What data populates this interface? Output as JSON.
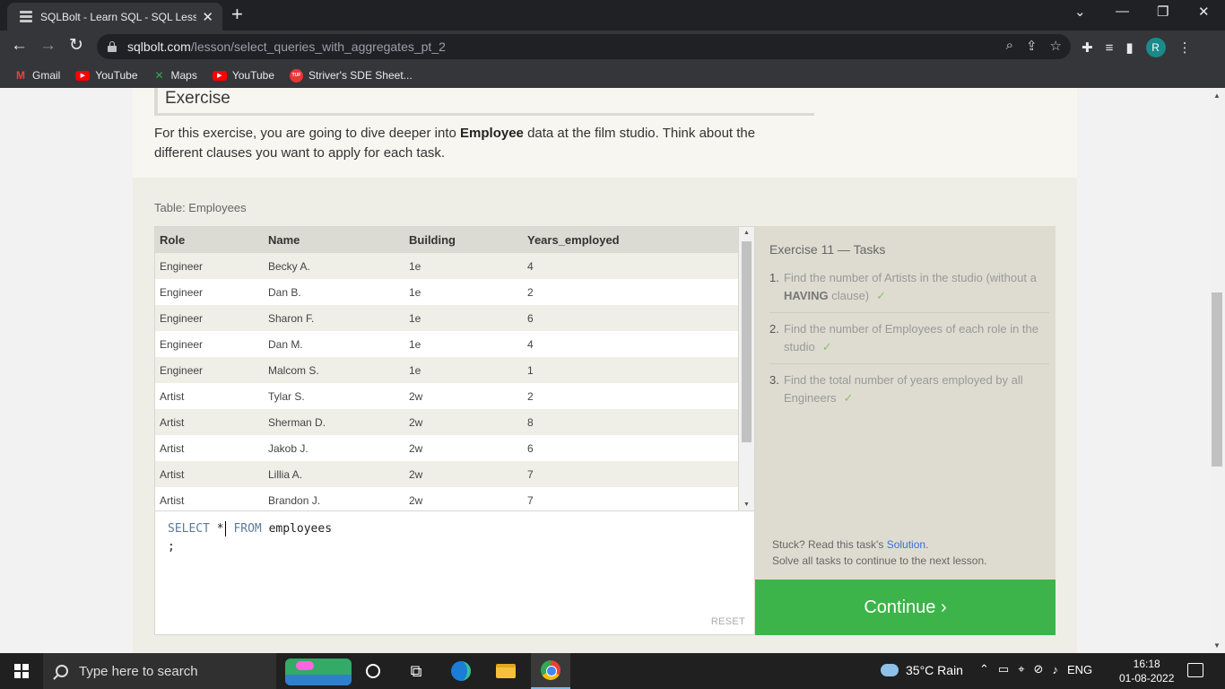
{
  "browser": {
    "tab_title": "SQLBolt - Learn SQL - SQL Lesso",
    "url_host": "sqlbolt.com",
    "url_path": "/lesson/select_queries_with_aggregates_pt_2",
    "avatar_letter": "R",
    "bookmarks": [
      {
        "label": "Gmail",
        "icon": "gmail-icon"
      },
      {
        "label": "YouTube",
        "icon": "youtube-icon"
      },
      {
        "label": "Maps",
        "icon": "maps-icon"
      },
      {
        "label": "YouTube",
        "icon": "youtube-icon"
      },
      {
        "label": "Striver's SDE Sheet...",
        "icon": "tuf-icon"
      }
    ]
  },
  "exercise": {
    "header": "Exercise",
    "intro_before": "For this exercise, you are going to dive deeper into ",
    "intro_bold": "Employee",
    "intro_after": " data at the film studio. Think about the different clauses you want to apply for each task.",
    "table_caption": "Table: Employees"
  },
  "table": {
    "columns": [
      "Role",
      "Name",
      "Building",
      "Years_employed"
    ],
    "rows": [
      [
        "Engineer",
        "Becky A.",
        "1e",
        "4"
      ],
      [
        "Engineer",
        "Dan B.",
        "1e",
        "2"
      ],
      [
        "Engineer",
        "Sharon F.",
        "1e",
        "6"
      ],
      [
        "Engineer",
        "Dan M.",
        "1e",
        "4"
      ],
      [
        "Engineer",
        "Malcom S.",
        "1e",
        "1"
      ],
      [
        "Artist",
        "Tylar S.",
        "2w",
        "2"
      ],
      [
        "Artist",
        "Sherman D.",
        "2w",
        "8"
      ],
      [
        "Artist",
        "Jakob J.",
        "2w",
        "6"
      ],
      [
        "Artist",
        "Lillia A.",
        "2w",
        "7"
      ],
      [
        "Artist",
        "Brandon J.",
        "2w",
        "7"
      ]
    ]
  },
  "editor": {
    "kw_select": "SELECT",
    "star": "*",
    "kw_from": "FROM",
    "table_name": "employees",
    "line2": ";",
    "reset_label": "RESET"
  },
  "tasks": {
    "title": "Exercise 11 — Tasks",
    "items": [
      {
        "num": "1.",
        "before": "Find the number of Artists in the studio (without a ",
        "bold": "HAVING",
        "after": " clause)",
        "check": "✓"
      },
      {
        "num": "2.",
        "before": "Find the number of Employees of each role in the studio",
        "bold": "",
        "after": "",
        "check": "✓"
      },
      {
        "num": "3.",
        "before": "Find the total number of years employed by all Engineers",
        "bold": "",
        "after": "",
        "check": "✓"
      }
    ],
    "stuck_text": "Stuck? Read this task's ",
    "solution_link": "Solution",
    "stuck_end": ".",
    "solve_all": "Solve all tasks to continue to the next lesson.",
    "continue_label": "Continue ›"
  },
  "taskbar": {
    "search_placeholder": "Type here to search",
    "weather": "35°C  Rain",
    "lang": "ENG",
    "time": "16:18",
    "date": "01-08-2022"
  }
}
